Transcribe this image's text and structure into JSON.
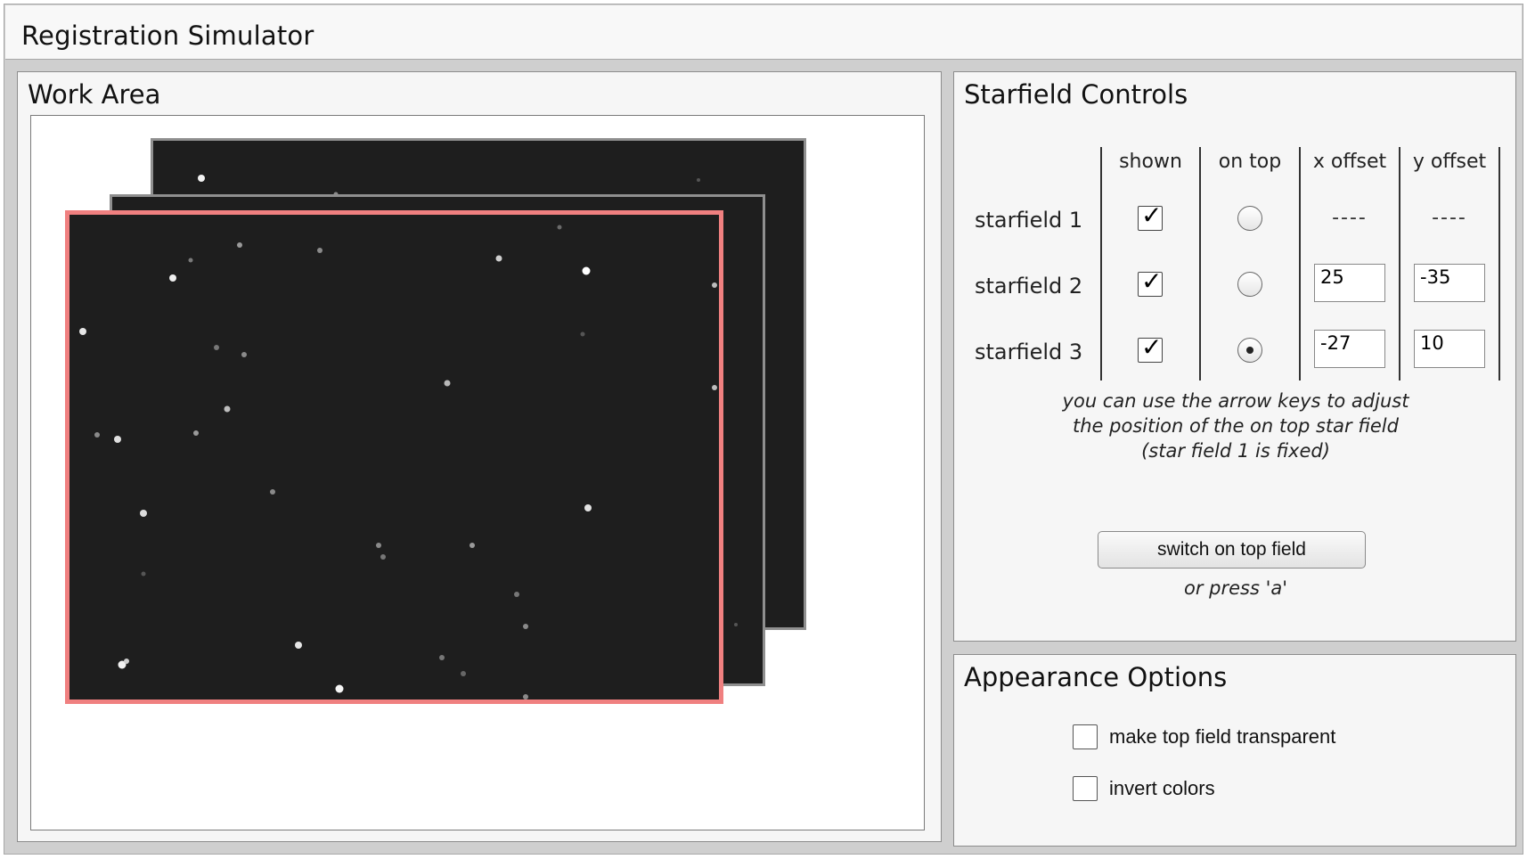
{
  "app": {
    "title": "Registration Simulator"
  },
  "work_area": {
    "title": "Work Area"
  },
  "starfield_controls": {
    "title": "Starfield Controls",
    "columns": {
      "shown": "shown",
      "on_top": "on top",
      "x_offset": "x offset",
      "y_offset": "y offset"
    },
    "rows": [
      {
        "label": "starfield 1",
        "shown": true,
        "on_top": false,
        "x_offset": "----",
        "y_offset": "----"
      },
      {
        "label": "starfield 2",
        "shown": true,
        "on_top": false,
        "x_offset": "25",
        "y_offset": "-35"
      },
      {
        "label": "starfield 3",
        "shown": true,
        "on_top": true,
        "x_offset": "-27",
        "y_offset": "10"
      }
    ],
    "hint_lines": [
      "you can use the arrow keys to adjust",
      "the position of the on top star field",
      "(star field 1 is fixed)"
    ],
    "switch_button": "switch on top field",
    "press_hint": "or press 'a'"
  },
  "appearance_options": {
    "title": "Appearance Options",
    "options": [
      {
        "label": "make top field transparent",
        "checked": false
      },
      {
        "label": "invert colors",
        "checked": false
      }
    ]
  },
  "colors": {
    "top_field_border": "#f08080",
    "field_bg": "#1e1e1e",
    "panel_bg": "#f6f6f6"
  }
}
